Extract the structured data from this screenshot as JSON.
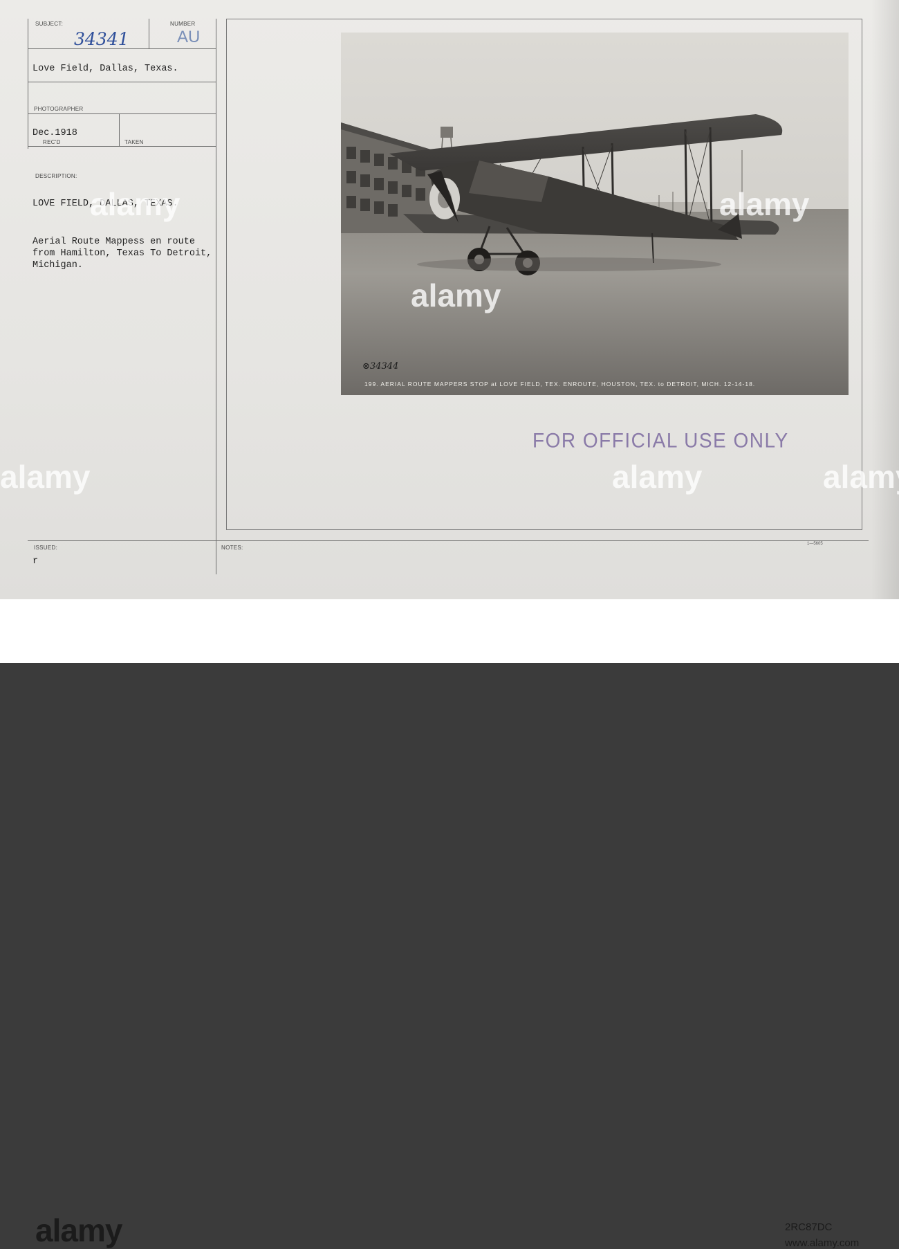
{
  "card": {
    "labels": {
      "subject": "SUBJECT:",
      "number": "NUMBER",
      "photographer": "PHOTOGRAPHER",
      "recd": "REC'D",
      "taken": "TAKEN",
      "description": "DESCRIPTION:",
      "issued": "ISSUED:",
      "notes": "NOTES:"
    },
    "subject_number": "34341",
    "number_code": "AU",
    "subject_text": "Love Field, Dallas, Texas.",
    "recd_date": "Dec.1918",
    "description_title": "LOVE FIELD, DALLAS, TEXAS.",
    "description_lines": [
      "Aerial Route Mappess en route",
      "from Hamilton, Texas To Detroit,",
      "Michigan."
    ],
    "issued_value": "r",
    "small_code": "1—5605"
  },
  "photo": {
    "caption": "199. AERIAL ROUTE MAPPERS STOP at LOVE FIELD, TEX. ENROUTE,  HOUSTON, TEX. to DETROIT, MICH.  12-14-18.",
    "negative_number": "34344",
    "stamp": "FOR OFFICIAL USE ONLY"
  },
  "watermark": {
    "text": "alamy",
    "image_id": "2RC87DC",
    "url": "www.alamy.com"
  },
  "colors": {
    "card_bg": "#e8e7e4",
    "handwriting": "#2f4f9a",
    "stamp": "#8a7aa8",
    "frame": "#0f0f0f"
  }
}
